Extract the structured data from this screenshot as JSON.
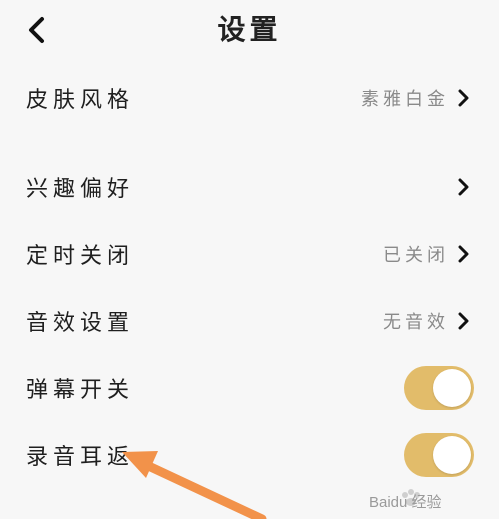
{
  "header": {
    "title": "设置"
  },
  "settings": {
    "skin": {
      "label": "皮肤风格",
      "value": "素雅白金"
    },
    "interests": {
      "label": "兴趣偏好"
    },
    "timer": {
      "label": "定时关闭",
      "value": "已关闭"
    },
    "sound": {
      "label": "音效设置",
      "value": "无音效"
    },
    "danmaku": {
      "label": "弹幕开关",
      "enabled": true
    },
    "earback": {
      "label": "录音耳返",
      "enabled": true
    }
  },
  "colors": {
    "toggle_on": "#e2bc6a",
    "annotation_arrow": "#f2924a",
    "background": "#f7f7f7"
  },
  "icons": {
    "back": "chevron-left-icon",
    "row_chevron": "chevron-right-icon",
    "watermark": "baidu-jingyan-logo"
  },
  "watermark_text": "Baidu 经验"
}
